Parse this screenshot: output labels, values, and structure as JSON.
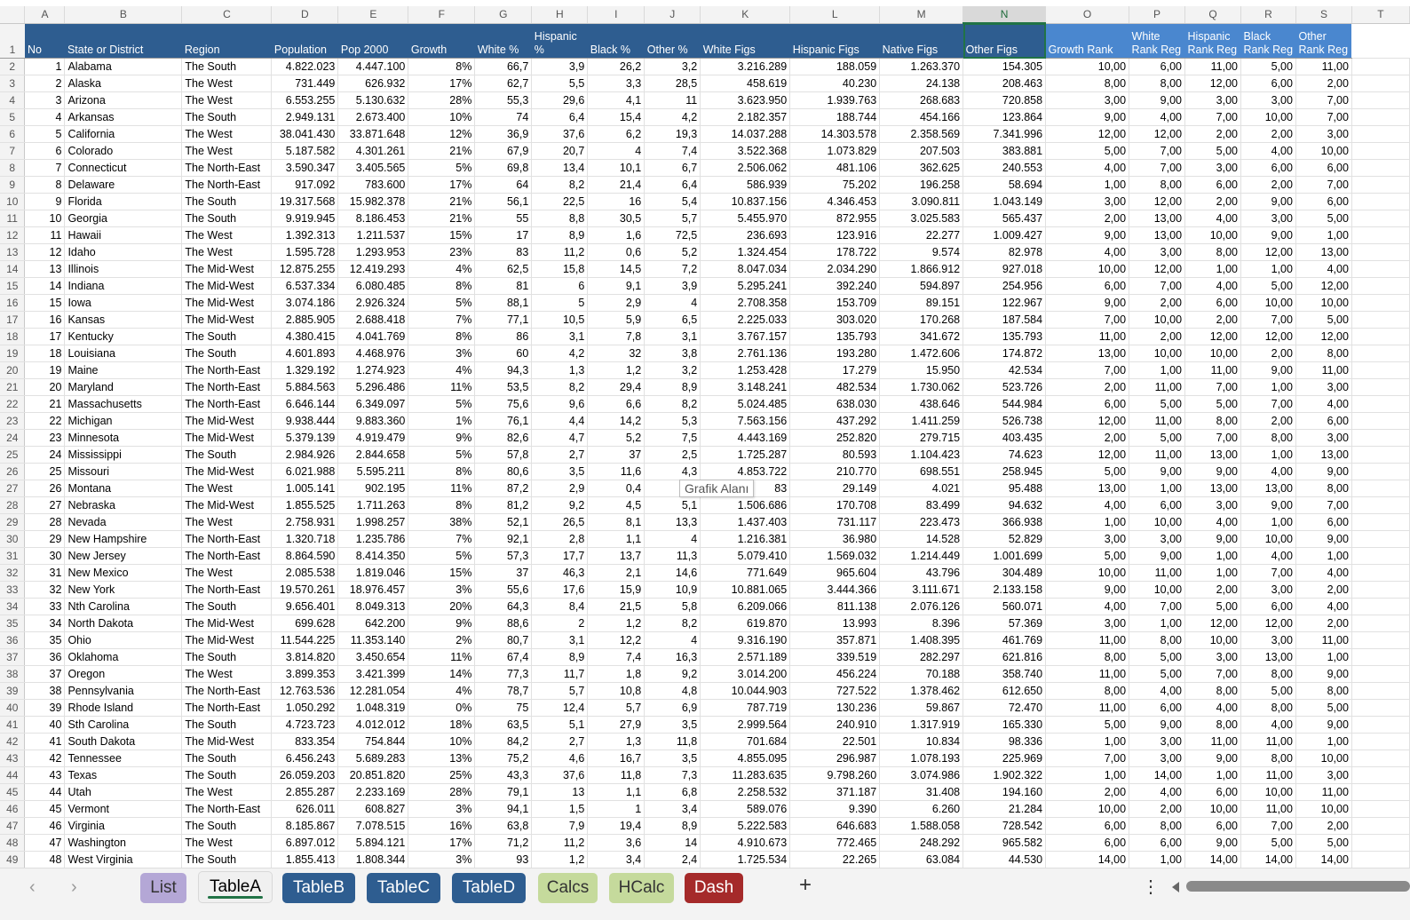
{
  "columns": [
    "A",
    "B",
    "C",
    "D",
    "E",
    "F",
    "G",
    "H",
    "I",
    "J",
    "K",
    "L",
    "M",
    "N",
    "O",
    "P",
    "Q",
    "R",
    "S",
    "T"
  ],
  "selected_column": "N",
  "headers": [
    "No",
    "State or District",
    "Region",
    "Population",
    "Pop 2000",
    "Growth",
    "White %",
    "Hispanic %",
    "Black %",
    "Other %",
    "White Figs",
    "Hispanic Figs",
    "Native Figs",
    "Other Figs",
    "Growth Rank",
    "White Rank Reg",
    "Hispanic Rank Reg",
    "Black Rank Reg",
    "Other Rank Reg"
  ],
  "rows": [
    [
      "1",
      "Alabama",
      "The South",
      "4.822.023",
      "4.447.100",
      "8%",
      "66,7",
      "3,9",
      "26,2",
      "3,2",
      "3.216.289",
      "188.059",
      "1.263.370",
      "154.305",
      "10,00",
      "6,00",
      "11,00",
      "5,00",
      "11,00"
    ],
    [
      "2",
      "Alaska",
      "The West",
      "731.449",
      "626.932",
      "17%",
      "62,7",
      "5,5",
      "3,3",
      "28,5",
      "458.619",
      "40.230",
      "24.138",
      "208.463",
      "8,00",
      "8,00",
      "12,00",
      "6,00",
      "2,00"
    ],
    [
      "3",
      "Arizona",
      "The West",
      "6.553.255",
      "5.130.632",
      "28%",
      "55,3",
      "29,6",
      "4,1",
      "11",
      "3.623.950",
      "1.939.763",
      "268.683",
      "720.858",
      "3,00",
      "9,00",
      "3,00",
      "3,00",
      "7,00"
    ],
    [
      "4",
      "Arkansas",
      "The South",
      "2.949.131",
      "2.673.400",
      "10%",
      "74",
      "6,4",
      "15,4",
      "4,2",
      "2.182.357",
      "188.744",
      "454.166",
      "123.864",
      "9,00",
      "4,00",
      "7,00",
      "10,00",
      "7,00"
    ],
    [
      "5",
      "California",
      "The West",
      "38.041.430",
      "33.871.648",
      "12%",
      "36,9",
      "37,6",
      "6,2",
      "19,3",
      "14.037.288",
      "14.303.578",
      "2.358.569",
      "7.341.996",
      "12,00",
      "12,00",
      "2,00",
      "2,00",
      "3,00"
    ],
    [
      "6",
      "Colorado",
      "The West",
      "5.187.582",
      "4.301.261",
      "21%",
      "67,9",
      "20,7",
      "4",
      "7,4",
      "3.522.368",
      "1.073.829",
      "207.503",
      "383.881",
      "5,00",
      "7,00",
      "5,00",
      "4,00",
      "10,00"
    ],
    [
      "7",
      "Connecticut",
      "The North-East",
      "3.590.347",
      "3.405.565",
      "5%",
      "69,8",
      "13,4",
      "10,1",
      "6,7",
      "2.506.062",
      "481.106",
      "362.625",
      "240.553",
      "4,00",
      "7,00",
      "3,00",
      "6,00",
      "6,00"
    ],
    [
      "8",
      "Delaware",
      "The North-East",
      "917.092",
      "783.600",
      "17%",
      "64",
      "8,2",
      "21,4",
      "6,4",
      "586.939",
      "75.202",
      "196.258",
      "58.694",
      "1,00",
      "8,00",
      "6,00",
      "2,00",
      "7,00"
    ],
    [
      "9",
      "Florida",
      "The South",
      "19.317.568",
      "15.982.378",
      "21%",
      "56,1",
      "22,5",
      "16",
      "5,4",
      "10.837.156",
      "4.346.453",
      "3.090.811",
      "1.043.149",
      "3,00",
      "12,00",
      "2,00",
      "9,00",
      "6,00"
    ],
    [
      "10",
      "Georgia",
      "The South",
      "9.919.945",
      "8.186.453",
      "21%",
      "55",
      "8,8",
      "30,5",
      "5,7",
      "5.455.970",
      "872.955",
      "3.025.583",
      "565.437",
      "2,00",
      "13,00",
      "4,00",
      "3,00",
      "5,00"
    ],
    [
      "11",
      "Hawaii",
      "The West",
      "1.392.313",
      "1.211.537",
      "15%",
      "17",
      "8,9",
      "1,6",
      "72,5",
      "236.693",
      "123.916",
      "22.277",
      "1.009.427",
      "9,00",
      "13,00",
      "10,00",
      "9,00",
      "1,00"
    ],
    [
      "12",
      "Idaho",
      "The West",
      "1.595.728",
      "1.293.953",
      "23%",
      "83",
      "11,2",
      "0,6",
      "5,2",
      "1.324.454",
      "178.722",
      "9.574",
      "82.978",
      "4,00",
      "3,00",
      "8,00",
      "12,00",
      "13,00"
    ],
    [
      "13",
      "Illinois",
      "The Mid-West",
      "12.875.255",
      "12.419.293",
      "4%",
      "62,5",
      "15,8",
      "14,5",
      "7,2",
      "8.047.034",
      "2.034.290",
      "1.866.912",
      "927.018",
      "10,00",
      "12,00",
      "1,00",
      "1,00",
      "4,00"
    ],
    [
      "14",
      "Indiana",
      "The Mid-West",
      "6.537.334",
      "6.080.485",
      "8%",
      "81",
      "6",
      "9,1",
      "3,9",
      "5.295.241",
      "392.240",
      "594.897",
      "254.956",
      "6,00",
      "7,00",
      "4,00",
      "5,00",
      "12,00"
    ],
    [
      "15",
      "Iowa",
      "The Mid-West",
      "3.074.186",
      "2.926.324",
      "5%",
      "88,1",
      "5",
      "2,9",
      "4",
      "2.708.358",
      "153.709",
      "89.151",
      "122.967",
      "9,00",
      "2,00",
      "6,00",
      "10,00",
      "10,00"
    ],
    [
      "16",
      "Kansas",
      "The Mid-West",
      "2.885.905",
      "2.688.418",
      "7%",
      "77,1",
      "10,5",
      "5,9",
      "6,5",
      "2.225.033",
      "303.020",
      "170.268",
      "187.584",
      "7,00",
      "10,00",
      "2,00",
      "7,00",
      "5,00"
    ],
    [
      "17",
      "Kentucky",
      "The South",
      "4.380.415",
      "4.041.769",
      "8%",
      "86",
      "3,1",
      "7,8",
      "3,1",
      "3.767.157",
      "135.793",
      "341.672",
      "135.793",
      "11,00",
      "2,00",
      "12,00",
      "12,00",
      "12,00"
    ],
    [
      "18",
      "Louisiana",
      "The South",
      "4.601.893",
      "4.468.976",
      "3%",
      "60",
      "4,2",
      "32",
      "3,8",
      "2.761.136",
      "193.280",
      "1.472.606",
      "174.872",
      "13,00",
      "10,00",
      "10,00",
      "2,00",
      "8,00"
    ],
    [
      "19",
      "Maine",
      "The North-East",
      "1.329.192",
      "1.274.923",
      "4%",
      "94,3",
      "1,3",
      "1,2",
      "3,2",
      "1.253.428",
      "17.279",
      "15.950",
      "42.534",
      "7,00",
      "1,00",
      "11,00",
      "9,00",
      "11,00"
    ],
    [
      "20",
      "Maryland",
      "The North-East",
      "5.884.563",
      "5.296.486",
      "11%",
      "53,5",
      "8,2",
      "29,4",
      "8,9",
      "3.148.241",
      "482.534",
      "1.730.062",
      "523.726",
      "2,00",
      "11,00",
      "7,00",
      "1,00",
      "3,00"
    ],
    [
      "21",
      "Massachusetts",
      "The North-East",
      "6.646.144",
      "6.349.097",
      "5%",
      "75,6",
      "9,6",
      "6,6",
      "8,2",
      "5.024.485",
      "638.030",
      "438.646",
      "544.984",
      "6,00",
      "5,00",
      "5,00",
      "7,00",
      "4,00"
    ],
    [
      "22",
      "Michigan",
      "The Mid-West",
      "9.938.444",
      "9.883.360",
      "1%",
      "76,1",
      "4,4",
      "14,2",
      "5,3",
      "7.563.156",
      "437.292",
      "1.411.259",
      "526.738",
      "12,00",
      "11,00",
      "8,00",
      "2,00",
      "6,00"
    ],
    [
      "23",
      "Minnesota",
      "The Mid-West",
      "5.379.139",
      "4.919.479",
      "9%",
      "82,6",
      "4,7",
      "5,2",
      "7,5",
      "4.443.169",
      "252.820",
      "279.715",
      "403.435",
      "2,00",
      "5,00",
      "7,00",
      "8,00",
      "3,00"
    ],
    [
      "24",
      "Mississippi",
      "The South",
      "2.984.926",
      "2.844.658",
      "5%",
      "57,8",
      "2,7",
      "37",
      "2,5",
      "1.725.287",
      "80.593",
      "1.104.423",
      "74.623",
      "12,00",
      "11,00",
      "13,00",
      "1,00",
      "13,00"
    ],
    [
      "25",
      "Missouri",
      "The Mid-West",
      "6.021.988",
      "5.595.211",
      "8%",
      "80,6",
      "3,5",
      "11,6",
      "4,3",
      "4.853.722",
      "210.770",
      "698.551",
      "258.945",
      "5,00",
      "9,00",
      "9,00",
      "4,00",
      "9,00"
    ],
    [
      "26",
      "Montana",
      "The West",
      "1.005.141",
      "902.195",
      "11%",
      "87,2",
      "2,9",
      "0,4",
      "",
      "83",
      "29.149",
      "4.021",
      "95.488",
      "13,00",
      "1,00",
      "13,00",
      "13,00",
      "8,00"
    ],
    [
      "27",
      "Nebraska",
      "The Mid-West",
      "1.855.525",
      "1.711.263",
      "8%",
      "81,2",
      "9,2",
      "4,5",
      "5,1",
      "1.506.686",
      "170.708",
      "83.499",
      "94.632",
      "4,00",
      "6,00",
      "3,00",
      "9,00",
      "7,00"
    ],
    [
      "28",
      "Nevada",
      "The West",
      "2.758.931",
      "1.998.257",
      "38%",
      "52,1",
      "26,5",
      "8,1",
      "13,3",
      "1.437.403",
      "731.117",
      "223.473",
      "366.938",
      "1,00",
      "10,00",
      "4,00",
      "1,00",
      "6,00"
    ],
    [
      "29",
      "New Hampshire",
      "The North-East",
      "1.320.718",
      "1.235.786",
      "7%",
      "92,1",
      "2,8",
      "1,1",
      "4",
      "1.216.381",
      "36.980",
      "14.528",
      "52.829",
      "3,00",
      "3,00",
      "9,00",
      "10,00",
      "9,00"
    ],
    [
      "30",
      "New Jersey",
      "The North-East",
      "8.864.590",
      "8.414.350",
      "5%",
      "57,3",
      "17,7",
      "13,7",
      "11,3",
      "5.079.410",
      "1.569.032",
      "1.214.449",
      "1.001.699",
      "5,00",
      "9,00",
      "1,00",
      "4,00",
      "1,00"
    ],
    [
      "31",
      "New Mexico",
      "The West",
      "2.085.538",
      "1.819.046",
      "15%",
      "37",
      "46,3",
      "2,1",
      "14,6",
      "771.649",
      "965.604",
      "43.796",
      "304.489",
      "10,00",
      "11,00",
      "1,00",
      "7,00",
      "4,00"
    ],
    [
      "32",
      "New York",
      "The North-East",
      "19.570.261",
      "18.976.457",
      "3%",
      "55,6",
      "17,6",
      "15,9",
      "10,9",
      "10.881.065",
      "3.444.366",
      "3.111.671",
      "2.133.158",
      "9,00",
      "10,00",
      "2,00",
      "3,00",
      "2,00"
    ],
    [
      "33",
      "Nth Carolina",
      "The South",
      "9.656.401",
      "8.049.313",
      "20%",
      "64,3",
      "8,4",
      "21,5",
      "5,8",
      "6.209.066",
      "811.138",
      "2.076.126",
      "560.071",
      "4,00",
      "7,00",
      "5,00",
      "6,00",
      "4,00"
    ],
    [
      "34",
      "North Dakota",
      "The Mid-West",
      "699.628",
      "642.200",
      "9%",
      "88,6",
      "2",
      "1,2",
      "8,2",
      "619.870",
      "13.993",
      "8.396",
      "57.369",
      "3,00",
      "1,00",
      "12,00",
      "12,00",
      "2,00"
    ],
    [
      "35",
      "Ohio",
      "The Mid-West",
      "11.544.225",
      "11.353.140",
      "2%",
      "80,7",
      "3,1",
      "12,2",
      "4",
      "9.316.190",
      "357.871",
      "1.408.395",
      "461.769",
      "11,00",
      "8,00",
      "10,00",
      "3,00",
      "11,00"
    ],
    [
      "36",
      "Oklahoma",
      "The South",
      "3.814.820",
      "3.450.654",
      "11%",
      "67,4",
      "8,9",
      "7,4",
      "16,3",
      "2.571.189",
      "339.519",
      "282.297",
      "621.816",
      "8,00",
      "5,00",
      "3,00",
      "13,00",
      "1,00"
    ],
    [
      "37",
      "Oregon",
      "The West",
      "3.899.353",
      "3.421.399",
      "14%",
      "77,3",
      "11,7",
      "1,8",
      "9,2",
      "3.014.200",
      "456.224",
      "70.188",
      "358.740",
      "11,00",
      "5,00",
      "7,00",
      "8,00",
      "9,00"
    ],
    [
      "38",
      "Pennsylvania",
      "The North-East",
      "12.763.536",
      "12.281.054",
      "4%",
      "78,7",
      "5,7",
      "10,8",
      "4,8",
      "10.044.903",
      "727.522",
      "1.378.462",
      "612.650",
      "8,00",
      "4,00",
      "8,00",
      "5,00",
      "8,00"
    ],
    [
      "39",
      "Rhode Island",
      "The North-East",
      "1.050.292",
      "1.048.319",
      "0%",
      "75",
      "12,4",
      "5,7",
      "6,9",
      "787.719",
      "130.236",
      "59.867",
      "72.470",
      "11,00",
      "6,00",
      "4,00",
      "8,00",
      "5,00"
    ],
    [
      "40",
      "Sth Carolina",
      "The South",
      "4.723.723",
      "4.012.012",
      "18%",
      "63,5",
      "5,1",
      "27,9",
      "3,5",
      "2.999.564",
      "240.910",
      "1.317.919",
      "165.330",
      "5,00",
      "9,00",
      "8,00",
      "4,00",
      "9,00"
    ],
    [
      "41",
      "South Dakota",
      "The Mid-West",
      "833.354",
      "754.844",
      "10%",
      "84,2",
      "2,7",
      "1,3",
      "11,8",
      "701.684",
      "22.501",
      "10.834",
      "98.336",
      "1,00",
      "3,00",
      "11,00",
      "11,00",
      "1,00"
    ],
    [
      "42",
      "Tennessee",
      "The South",
      "6.456.243",
      "5.689.283",
      "13%",
      "75,2",
      "4,6",
      "16,7",
      "3,5",
      "4.855.095",
      "296.987",
      "1.078.193",
      "225.969",
      "7,00",
      "3,00",
      "9,00",
      "8,00",
      "10,00"
    ],
    [
      "43",
      "Texas",
      "The South",
      "26.059.203",
      "20.851.820",
      "25%",
      "43,3",
      "37,6",
      "11,8",
      "7,3",
      "11.283.635",
      "9.798.260",
      "3.074.986",
      "1.902.322",
      "1,00",
      "14,00",
      "1,00",
      "11,00",
      "3,00"
    ],
    [
      "44",
      "Utah",
      "The West",
      "2.855.287",
      "2.233.169",
      "28%",
      "79,1",
      "13",
      "1,1",
      "6,8",
      "2.258.532",
      "371.187",
      "31.408",
      "194.160",
      "2,00",
      "4,00",
      "6,00",
      "10,00",
      "11,00"
    ],
    [
      "45",
      "Vermont",
      "The North-East",
      "626.011",
      "608.827",
      "3%",
      "94,1",
      "1,5",
      "1",
      "3,4",
      "589.076",
      "9.390",
      "6.260",
      "21.284",
      "10,00",
      "2,00",
      "10,00",
      "11,00",
      "10,00"
    ],
    [
      "46",
      "Virginia",
      "The South",
      "8.185.867",
      "7.078.515",
      "16%",
      "63,8",
      "7,9",
      "19,4",
      "8,9",
      "5.222.583",
      "646.683",
      "1.588.058",
      "728.542",
      "6,00",
      "8,00",
      "6,00",
      "7,00",
      "2,00"
    ],
    [
      "47",
      "Washington",
      "The West",
      "6.897.012",
      "5.894.121",
      "17%",
      "71,2",
      "11,2",
      "3,6",
      "14",
      "4.910.673",
      "772.465",
      "248.292",
      "965.582",
      "6,00",
      "6,00",
      "9,00",
      "5,00",
      "5,00"
    ],
    [
      "48",
      "West Virginia",
      "The South",
      "1.855.413",
      "1.808.344",
      "3%",
      "93",
      "1,2",
      "3,4",
      "2,4",
      "1.725.534",
      "22.265",
      "63.084",
      "44.530",
      "14,00",
      "1,00",
      "14,00",
      "14,00",
      "14,00"
    ]
  ],
  "tooltip": "Grafik Alanı",
  "sheet_tabs": [
    {
      "label": "List",
      "color": "#b4a7d6",
      "text_color": "#333333"
    },
    {
      "label": "TableA",
      "active": true
    },
    {
      "label": "TableB",
      "color": "#2e5d90",
      "text_color": "#ffffff"
    },
    {
      "label": "TableC",
      "color": "#2e5d90",
      "text_color": "#ffffff"
    },
    {
      "label": "TableD",
      "color": "#2e5d90",
      "text_color": "#ffffff"
    },
    {
      "label": "Calcs",
      "color": "#c5da9c",
      "text_color": "#333333"
    },
    {
      "label": "HCalc",
      "color": "#c5da9c",
      "text_color": "#333333"
    },
    {
      "label": "Dash",
      "color": "#a52a2a",
      "text_color": "#ffffff"
    }
  ],
  "controls": {
    "prev": "‹",
    "next": "›",
    "add": "+",
    "more": "⋮"
  }
}
